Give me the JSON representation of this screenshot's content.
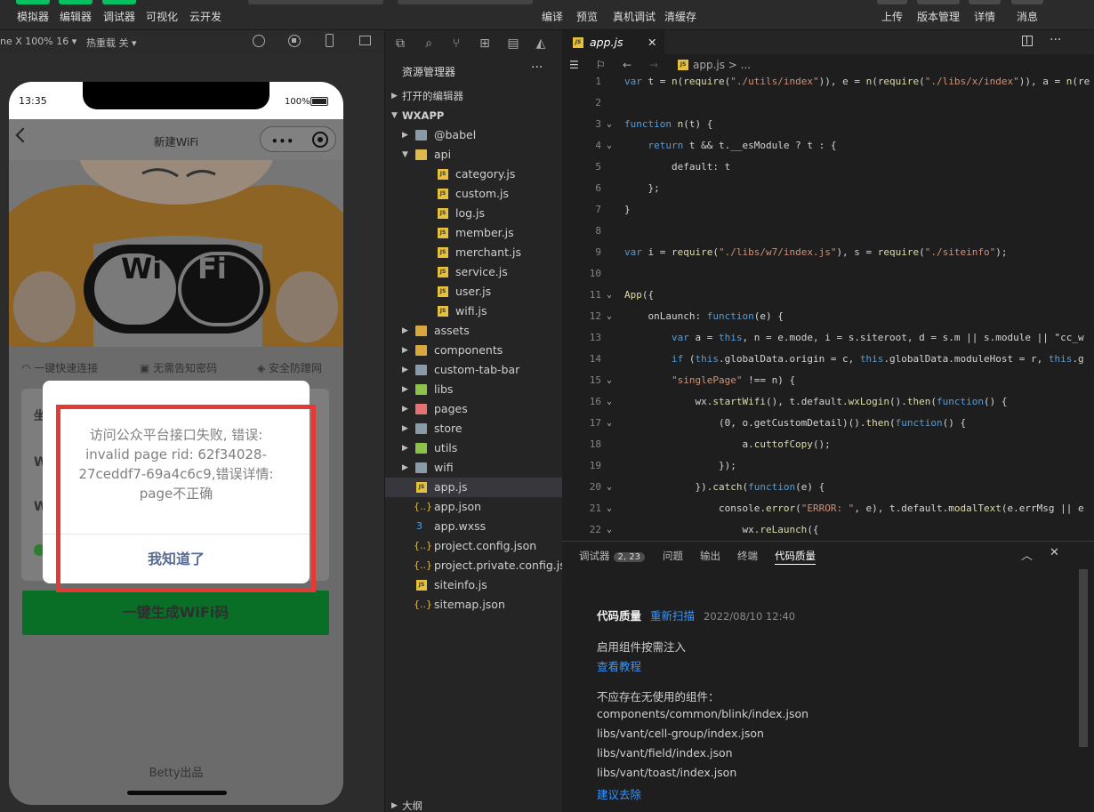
{
  "toolbar": {
    "left_buttons": [
      "模拟器",
      "编辑器",
      "调试器",
      "可视化",
      "云开发"
    ],
    "mid_buttons": [
      "编译",
      "预览",
      "真机调试",
      "清缓存"
    ],
    "right_buttons": [
      "上传",
      "版本管理",
      "详情",
      "消息"
    ]
  },
  "simulator": {
    "device": "ne X 100% 16 ▾",
    "hotreload": "热重载 关 ▾",
    "time": "13:35",
    "battery": "100%",
    "page_title": "新建WiFi",
    "features": [
      "一键快速连接",
      "无需告知密码",
      "安全防蹭网"
    ],
    "card_rows": [
      "坐",
      "W",
      "W"
    ],
    "big_button": "一键生成WiFi码",
    "footer": "Betty出品",
    "hero_sign_left": "Wi",
    "hero_sign_right": "Fi"
  },
  "dialog": {
    "message": "访问公众平台接口失败, 错误: invalid page rid: 62f34028-27ceddf7-69a4c6c9,错误详情: page不正确",
    "button": "我知道了"
  },
  "explorer": {
    "title": "资源管理器",
    "open_editors": "打开的编辑器",
    "project": "WXAPP",
    "outline": "大纲",
    "items": [
      {
        "name": "@babel",
        "kind": "folder",
        "depth": 1
      },
      {
        "name": "api",
        "kind": "folder-open",
        "depth": 1
      },
      {
        "name": "category.js",
        "kind": "js",
        "depth": 2
      },
      {
        "name": "custom.js",
        "kind": "js",
        "depth": 2
      },
      {
        "name": "log.js",
        "kind": "js",
        "depth": 2
      },
      {
        "name": "member.js",
        "kind": "js",
        "depth": 2
      },
      {
        "name": "merchant.js",
        "kind": "js",
        "depth": 2
      },
      {
        "name": "service.js",
        "kind": "js",
        "depth": 2
      },
      {
        "name": "user.js",
        "kind": "js",
        "depth": 2
      },
      {
        "name": "wifi.js",
        "kind": "js",
        "depth": 2
      },
      {
        "name": "assets",
        "kind": "folder",
        "depth": 1
      },
      {
        "name": "components",
        "kind": "folder",
        "depth": 1
      },
      {
        "name": "custom-tab-bar",
        "kind": "folder",
        "depth": 1
      },
      {
        "name": "libs",
        "kind": "folder",
        "depth": 1
      },
      {
        "name": "pages",
        "kind": "folder",
        "depth": 1
      },
      {
        "name": "store",
        "kind": "folder",
        "depth": 1
      },
      {
        "name": "utils",
        "kind": "folder",
        "depth": 1
      },
      {
        "name": "wifi",
        "kind": "folder",
        "depth": 1
      },
      {
        "name": "app.js",
        "kind": "js",
        "depth": 1,
        "selected": true
      },
      {
        "name": "app.json",
        "kind": "json",
        "depth": 1
      },
      {
        "name": "app.wxss",
        "kind": "css",
        "depth": 1
      },
      {
        "name": "project.config.json",
        "kind": "json",
        "depth": 1
      },
      {
        "name": "project.private.config.js...",
        "kind": "json",
        "depth": 1
      },
      {
        "name": "siteinfo.js",
        "kind": "js",
        "depth": 1
      },
      {
        "name": "sitemap.json",
        "kind": "json",
        "depth": 1
      }
    ]
  },
  "editor": {
    "tab": "app.js",
    "breadcrumb": "app.js > ...",
    "lines": [
      {
        "n": "1",
        "text": "var t = n(require(\"./utils/index\")), e = n(require(\"./libs/x/index\")), a = n(re"
      },
      {
        "n": "2",
        "text": ""
      },
      {
        "n": "3",
        "text": "function n(t) {"
      },
      {
        "n": "4",
        "text": "    return t && t.__esModule ? t : {"
      },
      {
        "n": "5",
        "text": "        default: t"
      },
      {
        "n": "6",
        "text": "    };"
      },
      {
        "n": "7",
        "text": "}"
      },
      {
        "n": "8",
        "text": ""
      },
      {
        "n": "9",
        "text": "var i = require(\"./libs/w7/index.js\"), s = require(\"./siteinfo\");"
      },
      {
        "n": "10",
        "text": ""
      },
      {
        "n": "11",
        "text": "App({"
      },
      {
        "n": "12",
        "text": "    onLaunch: function(e) {"
      },
      {
        "n": "13",
        "text": "        var a = this, n = e.mode, i = s.siteroot, d = s.m || s.module || \"cc_w"
      },
      {
        "n": "14",
        "text": "        if (this.globalData.origin = c, this.globalData.moduleHost = r, this.g"
      },
      {
        "n": "15",
        "text": "        \"singlePage\" !== n) {"
      },
      {
        "n": "16",
        "text": "            wx.startWifi(), t.default.wxLogin().then(function() {"
      },
      {
        "n": "17",
        "text": "                (0, o.getCustomDetail)().then(function() {"
      },
      {
        "n": "18",
        "text": "                    a.cuttofCopy();"
      },
      {
        "n": "19",
        "text": "                });"
      },
      {
        "n": "20",
        "text": "            }).catch(function(e) {"
      },
      {
        "n": "21",
        "text": "                console.error(\"ERROR: \", e), t.default.modalText(e.errMsg || e"
      },
      {
        "n": "22",
        "text": "                    wx.reLaunch({"
      }
    ]
  },
  "panel": {
    "tabs": [
      "调试器",
      "问题",
      "输出",
      "终端",
      "代码质量"
    ],
    "badge": "2, 23",
    "heading": "代码质量",
    "rescan": "重新扫描",
    "date": "2022/08/10 12:40",
    "hint1": "启用组件按需注入",
    "tutorial": "查看教程",
    "unused_title": "不应存在无使用的组件：",
    "unused": [
      "components/common/blink/index.json",
      "libs/vant/cell-group/index.json",
      "libs/vant/field/index.json",
      "libs/vant/toast/index.json"
    ],
    "suggest": "建议去除"
  },
  "colors": {
    "accent": "#07c160",
    "link": "#3794ff",
    "highlight_box": "#e53935",
    "dialog_button": "#576b95"
  }
}
